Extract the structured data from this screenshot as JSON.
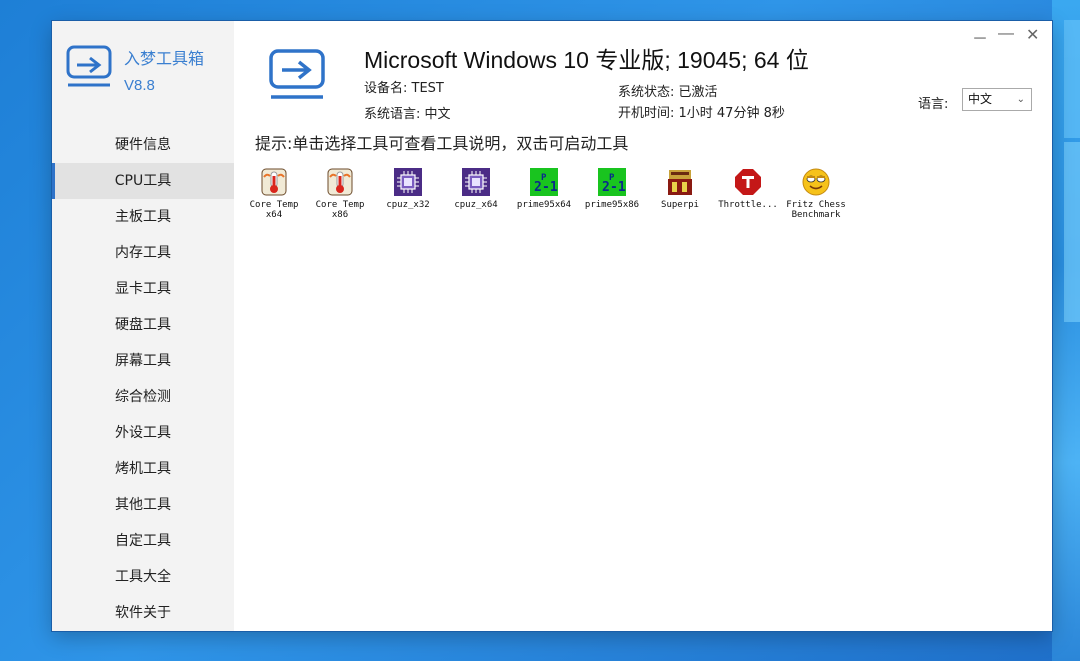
{
  "app": {
    "name": "入梦工具箱",
    "version": "V8.8"
  },
  "system": {
    "os_title": "Microsoft Windows 10 专业版; 19045; 64 位",
    "device_name": "设备名: TEST",
    "system_language": "系统语言: 中文",
    "activation_status": "系统状态: 已激活",
    "uptime": "开机时间: 1小时 47分钟 8秒"
  },
  "language": {
    "label": "语言:",
    "selected": "中文"
  },
  "window_controls": {
    "minimize": "－",
    "maximize": "—",
    "close": "✕"
  },
  "hint": "提示:单击选择工具可查看工具说明，双击可启动工具",
  "menu": [
    {
      "label": "硬件信息",
      "active": false
    },
    {
      "label": "CPU工具",
      "active": true
    },
    {
      "label": "主板工具",
      "active": false
    },
    {
      "label": "内存工具",
      "active": false
    },
    {
      "label": "显卡工具",
      "active": false
    },
    {
      "label": "硬盘工具",
      "active": false
    },
    {
      "label": "屏幕工具",
      "active": false
    },
    {
      "label": "综合检测",
      "active": false
    },
    {
      "label": "外设工具",
      "active": false
    },
    {
      "label": "烤机工具",
      "active": false
    },
    {
      "label": "其他工具",
      "active": false
    },
    {
      "label": "自定工具",
      "active": false
    },
    {
      "label": "工具大全",
      "active": false
    },
    {
      "label": "软件关于",
      "active": false
    }
  ],
  "tools": [
    {
      "label": "Core Temp\nx64",
      "icon": "thermometer-icon"
    },
    {
      "label": "Core Temp\nx86",
      "icon": "thermometer-icon"
    },
    {
      "label": "cpuz_x32",
      "icon": "cpu-chip-icon"
    },
    {
      "label": "cpuz_x64",
      "icon": "cpu-chip-icon"
    },
    {
      "label": "prime95x64",
      "icon": "prime95-icon"
    },
    {
      "label": "prime95x86",
      "icon": "prime95-icon"
    },
    {
      "label": "Superpi",
      "icon": "superpi-icon"
    },
    {
      "label": "Throttle...",
      "icon": "throttlestop-icon"
    },
    {
      "label": "Fritz Chess\nBenchmark",
      "icon": "fritz-smiley-icon"
    }
  ],
  "colors": {
    "accent": "#2f73c9",
    "brand_text": "#3a7fd0",
    "sidebar_bg": "#f3f3f3"
  }
}
